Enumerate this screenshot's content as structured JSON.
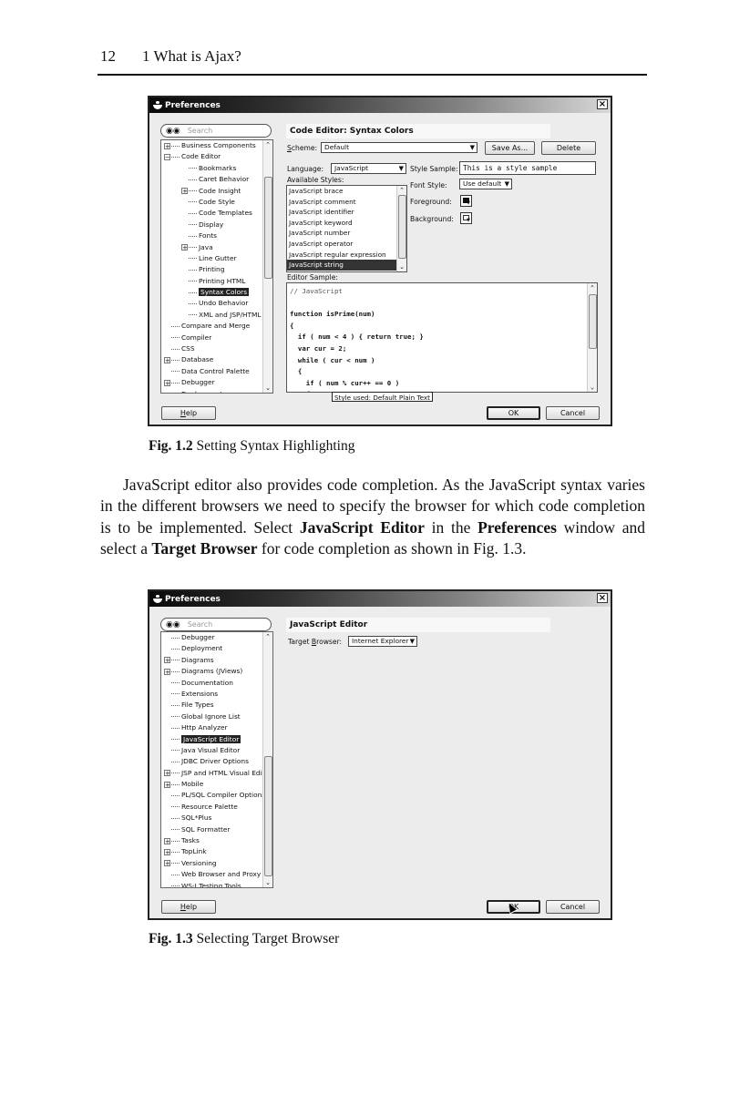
{
  "page": {
    "page_number": "12",
    "running_title": "1 What is Ajax?"
  },
  "figure_1_2": {
    "caption_label": "Fig. 1.2",
    "caption_text": " Setting Syntax Highlighting",
    "dialog": {
      "title": "Preferences",
      "close_glyph": "×",
      "search_placeholder": "Search",
      "tree": [
        {
          "label": "Business Components",
          "level": 0,
          "expander": "+"
        },
        {
          "label": "Code Editor",
          "level": 0,
          "expander": "−"
        },
        {
          "label": "Bookmarks",
          "level": 1
        },
        {
          "label": "Caret Behavior",
          "level": 1
        },
        {
          "label": "Code Insight",
          "level": 1,
          "expander": "+"
        },
        {
          "label": "Code Style",
          "level": 1
        },
        {
          "label": "Code Templates",
          "level": 1
        },
        {
          "label": "Display",
          "level": 1
        },
        {
          "label": "Fonts",
          "level": 1
        },
        {
          "label": "Java",
          "level": 1,
          "expander": "+"
        },
        {
          "label": "Line Gutter",
          "level": 1
        },
        {
          "label": "Printing",
          "level": 1
        },
        {
          "label": "Printing HTML",
          "level": 1
        },
        {
          "label": "Syntax Colors",
          "level": 1,
          "selected": true
        },
        {
          "label": "Undo Behavior",
          "level": 1
        },
        {
          "label": "XML and JSP/HTML",
          "level": 1
        },
        {
          "label": "Compare and Merge",
          "level": 0
        },
        {
          "label": "Compiler",
          "level": 0
        },
        {
          "label": "CSS",
          "level": 0
        },
        {
          "label": "Database",
          "level": 0,
          "expander": "+"
        },
        {
          "label": "Data Control Palette",
          "level": 0
        },
        {
          "label": "Debugger",
          "level": 0,
          "expander": "+"
        },
        {
          "label": "Deployment",
          "level": 0
        }
      ],
      "panel_title": "Code Editor: Syntax Colors",
      "scheme_label_u": "S",
      "scheme_label_rest": "cheme:",
      "scheme_value": "Default",
      "save_as_label": "Save As...",
      "delete_label": "Delete",
      "language_label": "Language:",
      "language_value": "JavaScript",
      "available_styles_label": "Available Styles:",
      "styles": [
        "JavaScript brace",
        "JavaScript comment",
        "JavaScript identifier",
        "JavaScript keyword",
        "JavaScript number",
        "JavaScript operator",
        "JavaScript regular expression",
        "JavaScript string"
      ],
      "selected_style_index": 7,
      "style_sample_label": "Style Sample:",
      "style_sample_value": "This is a style sample",
      "font_style_label": "Font Style:",
      "font_style_value": "Use default",
      "foreground_label": "Foreground:",
      "background_label": "Background:",
      "foreground_color": "#111111",
      "background_color": "#ffffff",
      "editor_sample_label": "Editor Sample:",
      "code_lines": [
        "// JavaScript",
        "",
        "function isPrime(num)",
        "{",
        "  if ( num < 4 ) { return true; }",
        "  var cur = 2;",
        "  while ( cur < num )",
        "  {",
        "    if ( num % cur++ == 0 )",
        "    {"
      ],
      "tooltip": "Style used: Default Plain Text",
      "help_label": "Help",
      "ok_label": "OK",
      "cancel_label": "Cancel"
    }
  },
  "body_paragraph": {
    "t1": "JavaScript editor also provides code completion. As the JavaScript syntax varies in the different browsers we need to specify the browser for which code completion is to be implemented. Select ",
    "b1": "JavaScript Editor",
    "t2": " in the ",
    "b2": "Preferences",
    "t3": " window and select a ",
    "b3": "Target Browser",
    "t4": " for code completion as shown in Fig. 1.3."
  },
  "figure_1_3": {
    "caption_label": "Fig. 1.3",
    "caption_text": " Selecting Target Browser",
    "dialog": {
      "title": "Preferences",
      "close_glyph": "×",
      "search_placeholder": "Search",
      "tree": [
        {
          "label": "Debugger",
          "level": 0
        },
        {
          "label": "Deployment",
          "level": 0
        },
        {
          "label": "Diagrams",
          "level": 0,
          "expander": "+"
        },
        {
          "label": "Diagrams (JViews)",
          "level": 0,
          "expander": "+"
        },
        {
          "label": "Documentation",
          "level": 0
        },
        {
          "label": "Extensions",
          "level": 0
        },
        {
          "label": "File Types",
          "level": 0
        },
        {
          "label": "Global Ignore List",
          "level": 0
        },
        {
          "label": "Http Analyzer",
          "level": 0
        },
        {
          "label": "JavaScript Editor",
          "level": 0,
          "selected": true
        },
        {
          "label": "Java Visual Editor",
          "level": 0
        },
        {
          "label": "JDBC Driver Options",
          "level": 0
        },
        {
          "label": "JSP and HTML Visual Editor",
          "level": 0,
          "expander": "+"
        },
        {
          "label": "Mobile",
          "level": 0,
          "expander": "+"
        },
        {
          "label": "PL/SQL Compiler Options",
          "level": 0
        },
        {
          "label": "Resource Palette",
          "level": 0
        },
        {
          "label": "SQL*Plus",
          "level": 0
        },
        {
          "label": "SQL Formatter",
          "level": 0
        },
        {
          "label": "Tasks",
          "level": 0,
          "expander": "+"
        },
        {
          "label": "TopLink",
          "level": 0,
          "expander": "+"
        },
        {
          "label": "Versioning",
          "level": 0,
          "expander": "+"
        },
        {
          "label": "Web Browser and Proxy",
          "level": 0
        },
        {
          "label": "WS-I Testing Tools",
          "level": 0
        }
      ],
      "panel_title": "JavaScript Editor",
      "target_browser_label": "Target Browser:",
      "target_browser_value": "Internet Explorer",
      "help_label": "Help",
      "ok_label": "OK",
      "cancel_label": "Cancel"
    }
  }
}
